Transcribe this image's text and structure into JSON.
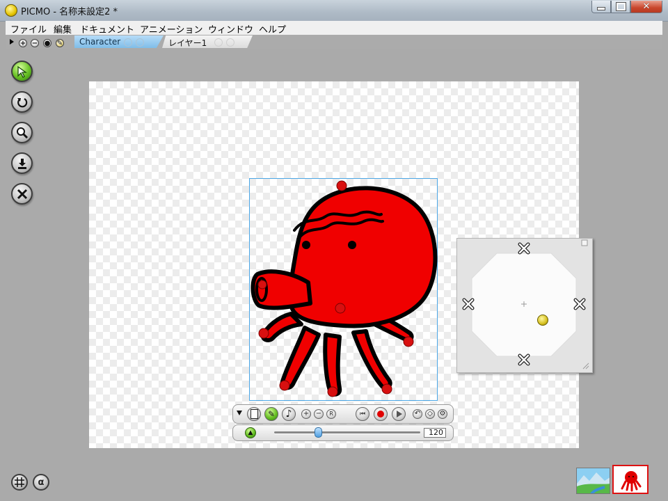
{
  "window": {
    "title": "PICMO - 名称未設定2 *",
    "icon": "picmo-app-icon"
  },
  "menu": [
    "ファイル",
    "編集",
    "ドキュメント",
    "アニメーション",
    "ウィンドウ",
    "ヘルプ"
  ],
  "layers": {
    "tabs": [
      {
        "label": "Character",
        "active": true
      },
      {
        "label": "レイヤー1",
        "active": false
      }
    ]
  },
  "tools": [
    "select-tool-icon",
    "rotate-icon",
    "zoom-icon",
    "import-icon",
    "cut-icon"
  ],
  "playback": {
    "speed": "120",
    "slider_fraction": 0.3,
    "record_color": "#e00000"
  },
  "bottom": {
    "grid_icon": "grid-icon",
    "alpha_label": "α"
  },
  "character": {
    "fill": "#f00000",
    "outline": "#000000"
  }
}
